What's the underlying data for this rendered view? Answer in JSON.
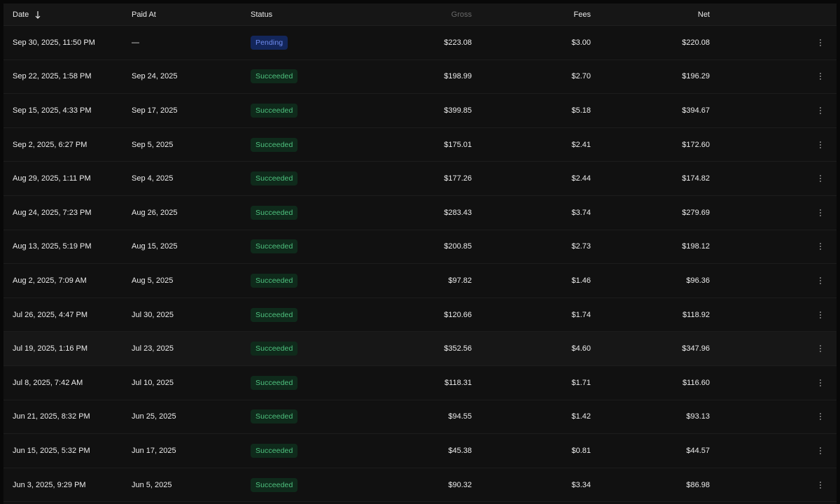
{
  "table": {
    "columns": {
      "date": "Date",
      "paid_at": "Paid At",
      "status": "Status",
      "gross": "Gross",
      "fees": "Fees",
      "net": "Net"
    },
    "sort": {
      "column": "date",
      "direction": "descending",
      "icon": "arrow-down-icon"
    },
    "row_menu_icon": "kebab-menu-icon",
    "status_colors": {
      "Succeeded": {
        "bg": "#0f2a1b",
        "fg": "#4fc27f"
      },
      "Pending": {
        "bg": "#13265a",
        "fg": "#6f8cf0"
      }
    },
    "rows": [
      {
        "date": "Sep 30, 2025, 11:50 PM",
        "paid_at": "—",
        "status": "Pending",
        "gross": "$223.08",
        "fees": "$3.00",
        "net": "$220.08"
      },
      {
        "date": "Sep 22, 2025, 1:58 PM",
        "paid_at": "Sep 24, 2025",
        "status": "Succeeded",
        "gross": "$198.99",
        "fees": "$2.70",
        "net": "$196.29"
      },
      {
        "date": "Sep 15, 2025, 4:33 PM",
        "paid_at": "Sep 17, 2025",
        "status": "Succeeded",
        "gross": "$399.85",
        "fees": "$5.18",
        "net": "$394.67"
      },
      {
        "date": "Sep 2, 2025, 6:27 PM",
        "paid_at": "Sep 5, 2025",
        "status": "Succeeded",
        "gross": "$175.01",
        "fees": "$2.41",
        "net": "$172.60"
      },
      {
        "date": "Aug 29, 2025, 1:11 PM",
        "paid_at": "Sep 4, 2025",
        "status": "Succeeded",
        "gross": "$177.26",
        "fees": "$2.44",
        "net": "$174.82"
      },
      {
        "date": "Aug 24, 2025, 7:23 PM",
        "paid_at": "Aug 26, 2025",
        "status": "Succeeded",
        "gross": "$283.43",
        "fees": "$3.74",
        "net": "$279.69"
      },
      {
        "date": "Aug 13, 2025, 5:19 PM",
        "paid_at": "Aug 15, 2025",
        "status": "Succeeded",
        "gross": "$200.85",
        "fees": "$2.73",
        "net": "$198.12"
      },
      {
        "date": "Aug 2, 2025, 7:09 AM",
        "paid_at": "Aug 5, 2025",
        "status": "Succeeded",
        "gross": "$97.82",
        "fees": "$1.46",
        "net": "$96.36"
      },
      {
        "date": "Jul 26, 2025, 4:47 PM",
        "paid_at": "Jul 30, 2025",
        "status": "Succeeded",
        "gross": "$120.66",
        "fees": "$1.74",
        "net": "$118.92"
      },
      {
        "date": "Jul 19, 2025, 1:16 PM",
        "paid_at": "Jul 23, 2025",
        "status": "Succeeded",
        "gross": "$352.56",
        "fees": "$4.60",
        "net": "$347.96"
      },
      {
        "date": "Jul 8, 2025, 7:42 AM",
        "paid_at": "Jul 10, 2025",
        "status": "Succeeded",
        "gross": "$118.31",
        "fees": "$1.71",
        "net": "$116.60"
      },
      {
        "date": "Jun 21, 2025, 8:32 PM",
        "paid_at": "Jun 25, 2025",
        "status": "Succeeded",
        "gross": "$94.55",
        "fees": "$1.42",
        "net": "$93.13"
      },
      {
        "date": "Jun 15, 2025, 5:32 PM",
        "paid_at": "Jun 17, 2025",
        "status": "Succeeded",
        "gross": "$45.38",
        "fees": "$0.81",
        "net": "$44.57"
      },
      {
        "date": "Jun 3, 2025, 9:29 PM",
        "paid_at": "Jun 5, 2025",
        "status": "Succeeded",
        "gross": "$90.32",
        "fees": "$3.34",
        "net": "$86.98"
      }
    ]
  }
}
